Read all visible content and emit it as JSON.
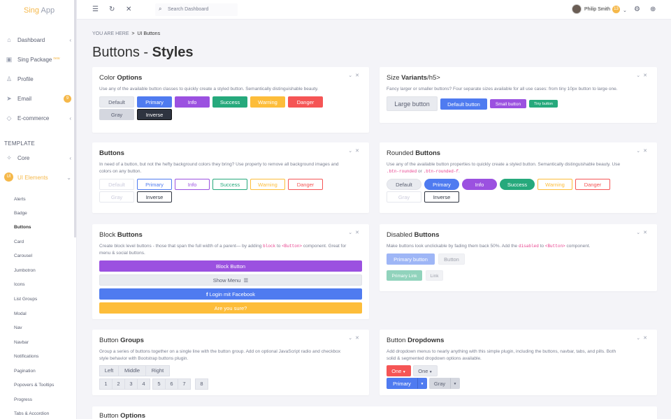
{
  "app": {
    "logo_main": "Sing",
    "logo_sub": "App"
  },
  "sidebar": {
    "items": [
      {
        "icon": "home-icon",
        "label": "Dashboard"
      },
      {
        "icon": "package-icon",
        "label": "Sing Package",
        "badge": "new"
      },
      {
        "icon": "user-icon",
        "label": "Profile"
      },
      {
        "icon": "send-icon",
        "label": "Email",
        "count": "9"
      },
      {
        "icon": "diamond-icon",
        "label": "E-commerce"
      }
    ],
    "section_label": "TEMPLATE",
    "core_label": "Core",
    "ui_elements": {
      "initials": "UI",
      "label": "UI Elements"
    },
    "sub_items": [
      "Alerts",
      "Badge",
      "Buttons",
      "Card",
      "Carousel",
      "Jumbotron",
      "Icons",
      "List Groups",
      "Modal",
      "Nav",
      "Navbar",
      "Notifications",
      "Pagination",
      "Popovers & Tooltips",
      "Progress",
      "Tabs & Accordion"
    ]
  },
  "topbar": {
    "search_placeholder": "Search Dashboard",
    "user_name": "Philip Smith",
    "user_badge": "13"
  },
  "breadcrumb": {
    "prefix": "YOU ARE HERE",
    "separator": ">",
    "current": "UI Buttons"
  },
  "page_title": {
    "light": "Buttons - ",
    "bold": "Styles"
  },
  "cards": {
    "color_options": {
      "title_light": "Color ",
      "title_bold": "Options",
      "desc": "Use any of the available button classes to quickly create a styled button. Semantically distinguishable beauty.",
      "buttons": [
        "Default",
        "Primary",
        "Info",
        "Success",
        "Warning",
        "Danger",
        "Gray",
        "Inverse"
      ]
    },
    "size_variants": {
      "title_light": "Size ",
      "title_bold": "Variants",
      "title_suffix": "/h5>",
      "desc": "Fancy larger or smaller buttons? Four separate sizes available for all use cases: from tiny 10px button to large one.",
      "buttons": [
        "Large button",
        "Default button",
        "Small button",
        "Tiny button"
      ]
    },
    "outline": {
      "title_bold": "Buttons",
      "desc1": "In need of a button, but not the hefty background colors they bring? Use property to remove all background images and",
      "desc2": "colors on any button.",
      "buttons": [
        "Default",
        "Primary",
        "Info",
        "Success",
        "Warning",
        "Danger",
        "Gray",
        "Inverse"
      ]
    },
    "rounded": {
      "title_light": "Rounded ",
      "title_bold": "Buttons",
      "desc1": "Use any of the available button properties to quickly create a styled button. Semantically distinguishable beauty. Use",
      "code1": ".btn-rounded",
      "or": " or ",
      "code2": ".btn-rounded-f",
      "period": ".",
      "buttons": [
        "Default",
        "Primary",
        "Info",
        "Success",
        "Warning",
        "Danger",
        "Gray",
        "Inverse"
      ]
    },
    "block": {
      "title_light": "Block ",
      "title_bold": "Buttons",
      "desc1a": "Create block level buttons - those that span the full width of a parent— by adding ",
      "code1": "block",
      "desc1b": " to ",
      "code2": "<Button>",
      "desc1c": " component. Great for",
      "desc2": "menu & social buttons.",
      "buttons": [
        "Block Button",
        "Show Menu",
        "Login mit Facebook",
        "Are you sure?"
      ]
    },
    "disabled": {
      "title_light": "Disabled ",
      "title_bold": "Buttons",
      "desc_a": "Make buttons look unclickable by fading them back 50%. Add the ",
      "code1": "disabled",
      "desc_b": " to ",
      "code2": "<Button>",
      "desc_c": " component.",
      "buttons": [
        "Primary button",
        "Button",
        "Primary Link",
        "Link"
      ]
    },
    "groups": {
      "title_light": "Button ",
      "title_bold": "Groups",
      "desc1": "Group a series of buttons together on a single line with the button group. Add on optional JavaScript radio and checkbox",
      "desc2": "style behavior with Bootstrap buttons plugin.",
      "align": [
        "Left",
        "Middle",
        "Right"
      ],
      "numbers": [
        "1",
        "2",
        "3",
        "4",
        "5",
        "6",
        "7",
        "8"
      ]
    },
    "dropdowns": {
      "title_light": "Button ",
      "title_bold": "Dropdowns",
      "desc1": "Add dropdown menus to nearly anything with this simple plugin, including the buttons, navbar, tabs, and pills. Both",
      "desc2": "solid & segmented dropdown options available.",
      "buttons": [
        "One",
        "One",
        "Primary",
        "Gray"
      ]
    },
    "options": {
      "title_light": "Button ",
      "title_bold": "Options"
    }
  }
}
